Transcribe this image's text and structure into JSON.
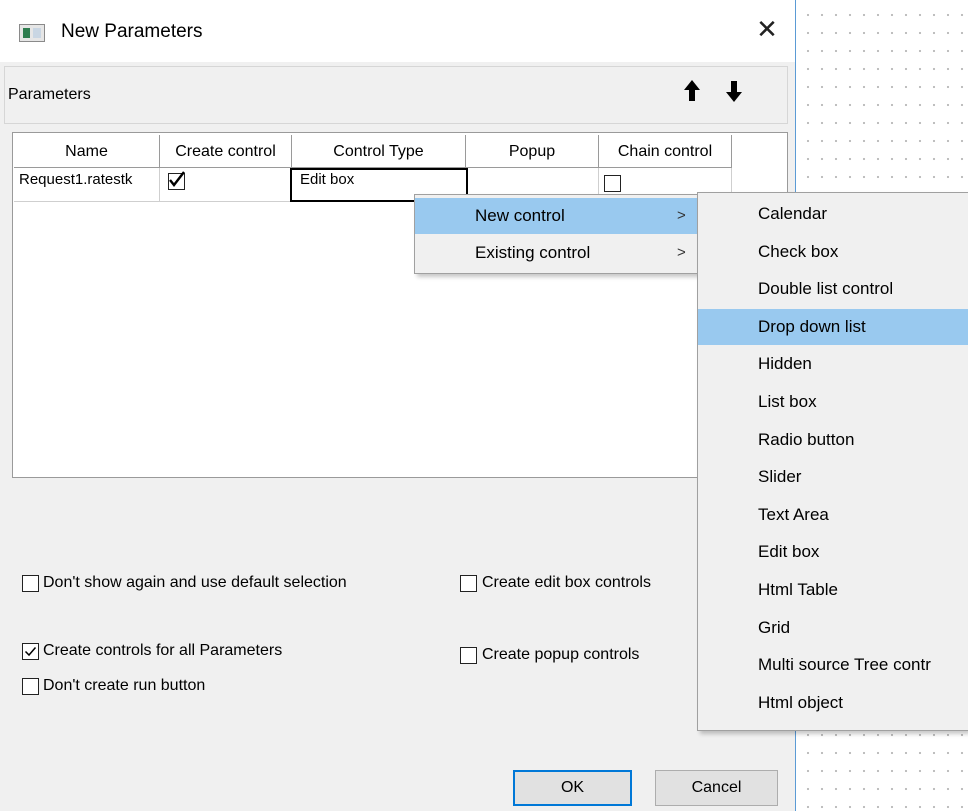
{
  "window": {
    "title": "New Parameters",
    "close_glyph": "✕"
  },
  "panel": {
    "label": "Parameters",
    "move_up_icon": "arrow-up-icon",
    "move_down_icon": "arrow-down-icon"
  },
  "table": {
    "columns": [
      "Name",
      "Create control",
      "Control Type",
      "Popup",
      "Chain control"
    ],
    "rows": [
      {
        "name": "Request1.ratestk",
        "create_control": true,
        "control_type": "Edit box",
        "popup": "",
        "chain_control": false
      }
    ]
  },
  "context_menu": {
    "items": [
      {
        "label": "New control",
        "submenu_glyph": ">",
        "highlighted": true
      },
      {
        "label": "Existing control",
        "submenu_glyph": ">",
        "highlighted": false
      }
    ]
  },
  "submenu": {
    "items": [
      "Calendar",
      "Check box",
      "Double list control",
      "Drop down list",
      "Hidden",
      "List box",
      "Radio button",
      "Slider",
      "Text Area",
      "Edit box",
      "Html Table",
      "Grid",
      "Multi source Tree contr",
      "Html object"
    ],
    "highlighted_index": 3
  },
  "options": {
    "dont_show_again": {
      "label": "Don't show again and use default selection",
      "checked": false
    },
    "create_edit_box": {
      "label": "Create edit box controls",
      "checked": false
    },
    "create_all": {
      "label": "Create controls for all Parameters",
      "checked": true
    },
    "create_popup": {
      "label": "Create popup controls",
      "checked": false
    },
    "no_run_button": {
      "label": "Don't create run button",
      "checked": false
    }
  },
  "buttons": {
    "ok": "OK",
    "cancel": "Cancel"
  },
  "colors": {
    "highlight": "#99c9ef",
    "default_button_border": "#0078d7",
    "dialog_bg": "#f0f0f0"
  }
}
